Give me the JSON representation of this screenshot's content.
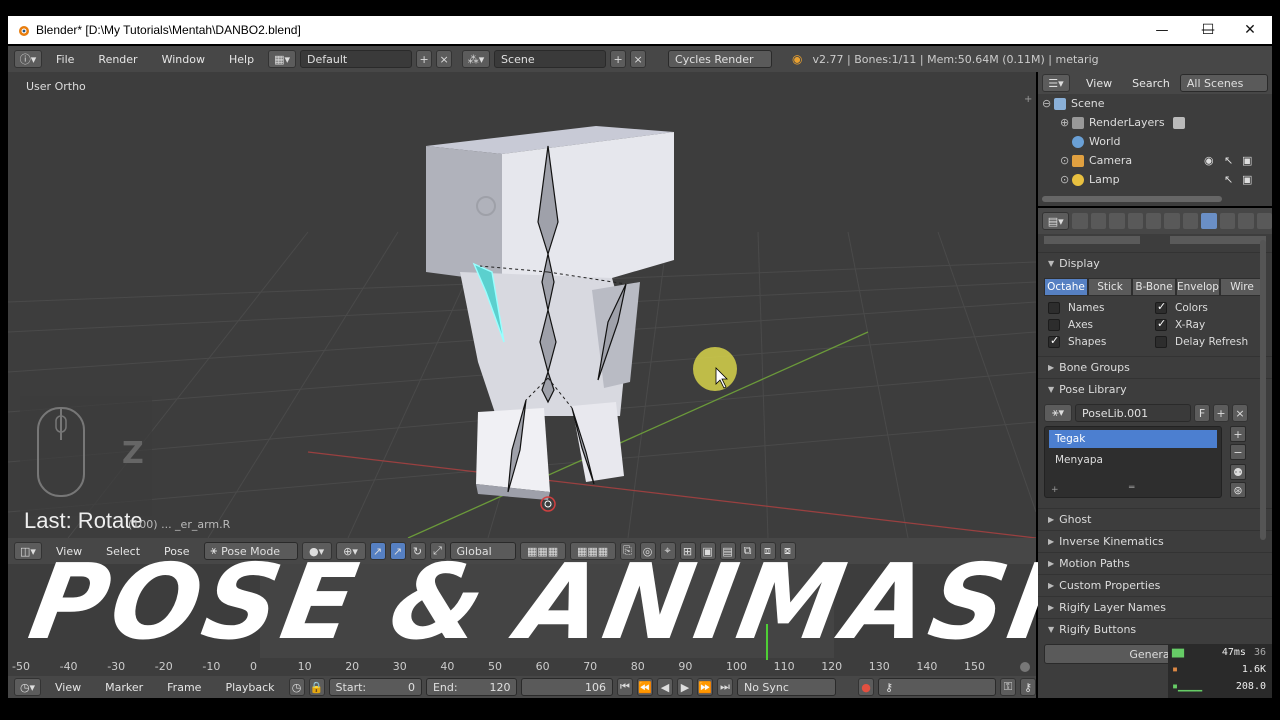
{
  "window": {
    "title": "Blender* [D:\\My Tutorials\\Mentah\\DANBO2.blend]",
    "minimize": "—",
    "maximize": "☐",
    "close": "✕"
  },
  "info_header": {
    "menus": [
      "File",
      "Render",
      "Window",
      "Help"
    ],
    "layout": "Default",
    "scene": "Scene",
    "engine": "Cycles Render",
    "stats": "v2.77 | Bones:1/11 | Mem:50.64M (0.11M) | metarig"
  },
  "viewport": {
    "view_label": "User Ortho",
    "last_operator": "Last: Rotate",
    "status_sub": "(100) ... _er_arm.R",
    "mouse_key": "Z"
  },
  "view3d_header": {
    "menus": [
      "View",
      "Select",
      "Pose"
    ],
    "mode": "Pose Mode",
    "orientation": "Global"
  },
  "overlay_title": {
    "left": "POSE",
    "amp": "&",
    "right": "ANIMASI"
  },
  "timeline": {
    "ticks": [
      "-50",
      "-40",
      "-30",
      "-20",
      "-10",
      "0",
      "10",
      "20",
      "30",
      "40",
      "50",
      "60",
      "70",
      "80",
      "90",
      "100",
      "110",
      "120",
      "130",
      "140",
      "150"
    ],
    "header_menus": [
      "View",
      "Marker",
      "Frame",
      "Playback"
    ],
    "start_label": "Start:",
    "start_value": "0",
    "end_label": "End:",
    "end_value": "120",
    "current_frame": "106",
    "sync": "No Sync"
  },
  "outliner": {
    "header": {
      "view": "View",
      "search": "Search",
      "filter": "All Scenes"
    },
    "items": [
      {
        "label": "Scene",
        "icon": "scene-icon"
      },
      {
        "label": "RenderLayers",
        "icon": "render-layers-icon"
      },
      {
        "label": "World",
        "icon": "world-icon"
      },
      {
        "label": "Camera",
        "icon": "camera-icon"
      },
      {
        "label": "Lamp",
        "icon": "lamp-icon"
      }
    ]
  },
  "properties": {
    "display": {
      "title": "Display",
      "draw_types": [
        "Octahe",
        "Stick",
        "B-Bone",
        "Envelop",
        "Wire"
      ],
      "active_draw_type": "Octahe",
      "options": [
        {
          "label": "Names",
          "checked": false
        },
        {
          "label": "Colors",
          "checked": true
        },
        {
          "label": "Axes",
          "checked": false
        },
        {
          "label": "X-Ray",
          "checked": true
        },
        {
          "label": "Shapes",
          "checked": true
        },
        {
          "label": "Delay Refresh",
          "checked": false
        }
      ]
    },
    "bone_groups": "Bone Groups",
    "pose_library": {
      "title": "Pose Library",
      "name": "PoseLib.001",
      "fake_user": "F",
      "poses": [
        "Tegak",
        "Menyapa"
      ],
      "selected": "Tegak"
    },
    "collapsed_panels": [
      "Ghost",
      "Inverse Kinematics",
      "Motion Paths",
      "Custom Properties",
      "Rigify Layer Names"
    ],
    "rigify_buttons": "Rigify Buttons",
    "generate": "Generate"
  },
  "perf_overlay": {
    "ms": "47ms",
    "fps": "36",
    "count1": "1.6K",
    "count2": "208.0"
  }
}
